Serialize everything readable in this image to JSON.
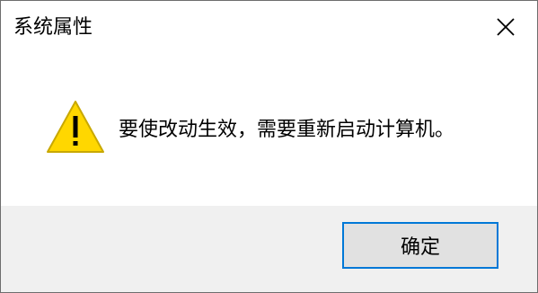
{
  "window": {
    "title": "系统属性"
  },
  "dialog": {
    "icon": "warning-icon",
    "message": "要使改动生效，需要重新启动计算机。",
    "ok_label": "确定"
  },
  "colors": {
    "warning_fill": "#ffd700",
    "warning_stroke": "#c8a800",
    "button_border": "#0078d7",
    "button_fill": "#e1e1e1",
    "footer_bg": "#f0f0f0"
  }
}
